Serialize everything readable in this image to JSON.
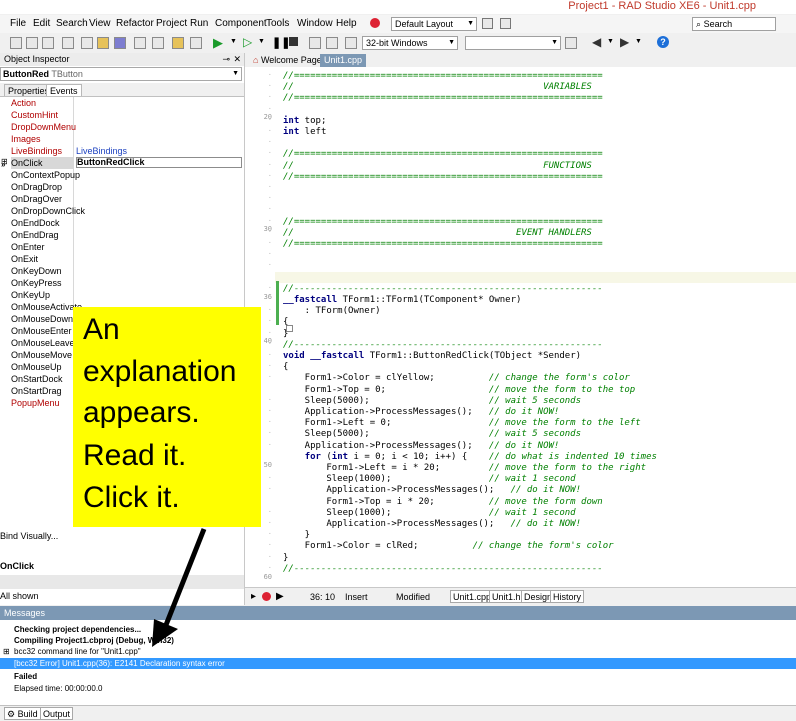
{
  "window": {
    "title": "Project1 - RAD Studio XE6 - Unit1.cpp"
  },
  "menu": [
    "File",
    "Edit",
    "Search",
    "View",
    "Refactor",
    "Project",
    "Run",
    "Component",
    "Tools",
    "Window",
    "Help"
  ],
  "toolbar": {
    "layout_combo": "Default Layout",
    "search_placeholder": "Search",
    "platform_combo": "32-bit Windows",
    "config_combo": ""
  },
  "object_inspector": {
    "title": "Object Inspector",
    "object_name": "ButtonRed",
    "object_type": "TButton",
    "tabs": [
      "Properties",
      "Events"
    ],
    "events": [
      {
        "name": "Action",
        "value": "",
        "red": true
      },
      {
        "name": "CustomHint",
        "value": "",
        "red": true
      },
      {
        "name": "DropDownMenu",
        "value": "",
        "red": true
      },
      {
        "name": "Images",
        "value": "",
        "red": true
      },
      {
        "name": "LiveBindings",
        "value": "LiveBindings",
        "red": true
      },
      {
        "name": "OnClick",
        "value": "ButtonRedClick",
        "red": false
      },
      {
        "name": "OnContextPopup",
        "value": "",
        "red": false
      },
      {
        "name": "OnDragDrop",
        "value": "",
        "red": false
      },
      {
        "name": "OnDragOver",
        "value": "",
        "red": false
      },
      {
        "name": "OnDropDownClick",
        "value": "",
        "red": false
      },
      {
        "name": "OnEndDock",
        "value": "",
        "red": false
      },
      {
        "name": "OnEndDrag",
        "value": "",
        "red": false
      },
      {
        "name": "OnEnter",
        "value": "",
        "red": false
      },
      {
        "name": "OnExit",
        "value": "",
        "red": false
      },
      {
        "name": "OnKeyDown",
        "value": "",
        "red": false
      },
      {
        "name": "OnKeyPress",
        "value": "",
        "red": false
      },
      {
        "name": "OnKeyUp",
        "value": "",
        "red": false
      },
      {
        "name": "OnMouseActivate",
        "value": "",
        "red": false
      },
      {
        "name": "OnMouseDown",
        "value": "",
        "red": false
      },
      {
        "name": "OnMouseEnter",
        "value": "",
        "red": false
      },
      {
        "name": "OnMouseLeave",
        "value": "",
        "red": false
      },
      {
        "name": "OnMouseMove",
        "value": "",
        "red": false
      },
      {
        "name": "OnMouseUp",
        "value": "",
        "red": false
      },
      {
        "name": "OnStartDock",
        "value": "",
        "red": false
      },
      {
        "name": "OnStartDrag",
        "value": "",
        "red": false
      },
      {
        "name": "PopupMenu",
        "value": "",
        "red": true
      }
    ],
    "bind_visually": "Bind Visually...",
    "selected_event": "OnClick",
    "filter": "All shown"
  },
  "editor": {
    "tabs": [
      "Welcome Page",
      "Unit1.cpp"
    ],
    "line_numbers": [
      "20",
      "30",
      "36",
      "40",
      "50",
      "60"
    ],
    "code": [
      "//=========================================================",
      "//                                              VARIABLES",
      "//=========================================================",
      "",
      "int top;",
      "int left",
      "",
      "//=========================================================",
      "//                                              FUNCTIONS",
      "//=========================================================",
      "",
      "",
      "",
      "//=========================================================",
      "//                                         EVENT HANDLERS",
      "//=========================================================",
      "",
      "",
      "",
      "//---------------------------------------------------------",
      "__fastcall TForm1::TForm1(TComponent* Owner)",
      "    : TForm(Owner)",
      "{",
      "}",
      "//---------------------------------------------------------",
      "void __fastcall TForm1::ButtonRedClick(TObject *Sender)",
      "{",
      "    Form1->Color = clYellow;          // change the form's color",
      "    Form1->Top = 0;                   // move the form to the top",
      "    Sleep(5000);                      // wait 5 seconds",
      "    Application->ProcessMessages();   // do it NOW!",
      "    Form1->Left = 0;                  // move the form to the left",
      "    Sleep(5000);                      // wait 5 seconds",
      "    Application->ProcessMessages();   // do it NOW!",
      "    for (int i = 0; i < 10; i++) {    // do what is indented 10 times",
      "        Form1->Left = i * 20;         // move the form to the right",
      "        Sleep(1000);                  // wait 1 second",
      "        Application->ProcessMessages();   // do it NOW!",
      "        Form1->Top = i * 20;          // move the form down",
      "        Sleep(1000);                  // wait 1 second",
      "        Application->ProcessMessages();   // do it NOW!",
      "    }",
      "    Form1->Color = clRed;          // change the form's color",
      "}",
      "//---------------------------------------------------------"
    ],
    "status": {
      "position": "36: 10",
      "mode": "Insert",
      "state": "Modified"
    },
    "bottom_tabs": [
      "Unit1.cpp",
      "Unit1.h",
      "Design",
      "History"
    ]
  },
  "messages": {
    "title": "Messages",
    "lines": [
      "Checking project dependencies...",
      "Compiling Project1.cbproj (Debug, Win32)",
      "bcc32 command line for \"Unit1.cpp\"",
      "[bcc32 Error] Unit1.cpp(36): E2141 Declaration syntax error",
      "Failed",
      "Elapsed time: 00:00:00.0"
    ],
    "tabs": [
      "Build",
      "Output"
    ]
  },
  "callout": {
    "lines": [
      "An",
      "explanation",
      "appears.",
      "Read it.",
      "Click it."
    ]
  }
}
